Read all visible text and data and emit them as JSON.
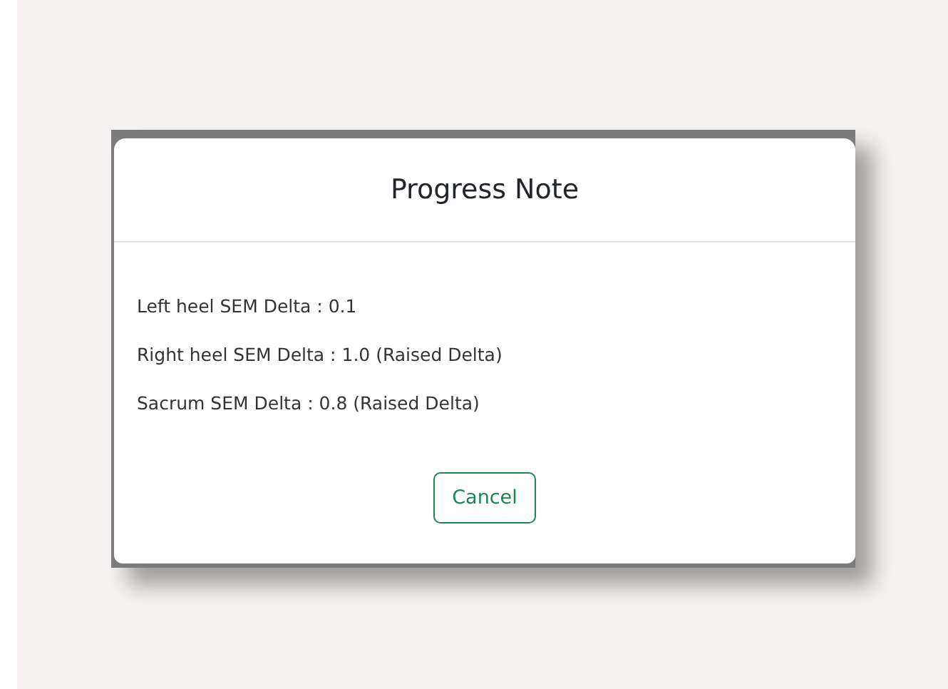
{
  "dialog": {
    "title": "Progress Note",
    "lines": [
      "Left heel SEM Delta : 0.1",
      "Right heel SEM Delta : 1.0 (Raised Delta)",
      "Sacrum SEM Delta : 0.8 (Raised Delta)"
    ],
    "buttons": [
      "Cancel"
    ]
  }
}
